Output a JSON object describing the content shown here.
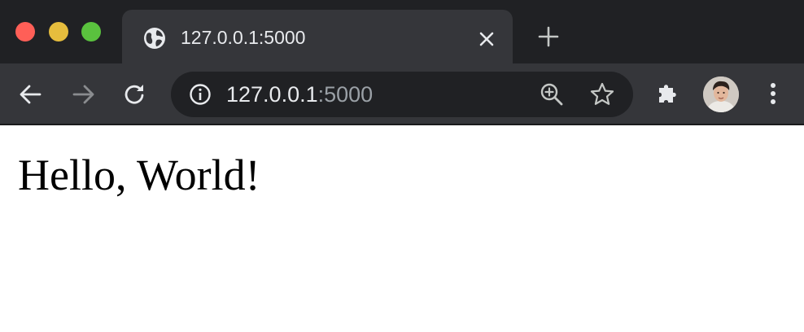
{
  "tab": {
    "title": "127.0.0.1:5000"
  },
  "omnibox": {
    "host": "127.0.0.1",
    "port": ":5000"
  },
  "page": {
    "heading": "Hello, World!"
  },
  "icons": {
    "favicon": "globe-icon",
    "tab_close": "close-icon",
    "new_tab": "plus-icon",
    "back": "arrow-left-icon",
    "forward": "arrow-right-icon",
    "reload": "reload-icon",
    "site_info": "info-icon",
    "zoom": "zoom-in-icon",
    "bookmark": "star-icon",
    "extensions": "puzzle-icon",
    "menu": "more-vert-icon"
  },
  "colors": {
    "titlebar": "#202124",
    "toolbar": "#35363a",
    "omnibox": "#202124",
    "traffic_close": "#ff5f57",
    "traffic_min": "#e6bd3d",
    "traffic_max": "#5ac23e"
  }
}
